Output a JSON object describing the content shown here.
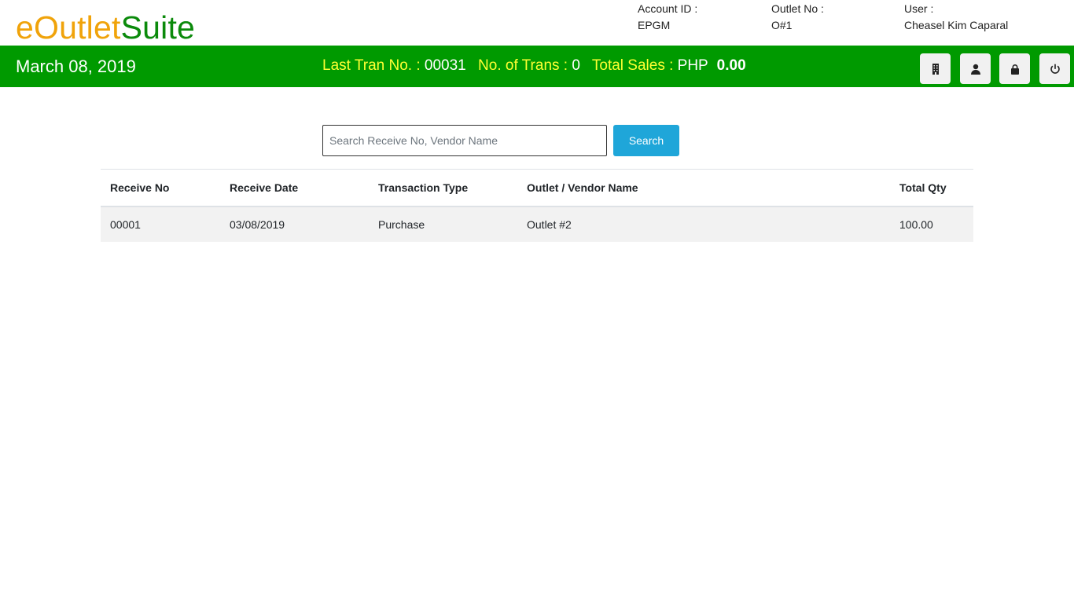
{
  "brand": {
    "part1": "eOutlet",
    "part2": "Suite"
  },
  "account": {
    "label": "Account ID :",
    "value": "EPGM"
  },
  "outlet": {
    "label": "Outlet No :",
    "value": "O#1"
  },
  "user": {
    "label": "User :",
    "value": "Cheasel Kim Caparal"
  },
  "bar": {
    "date": "March 08, 2019",
    "last_tran_label": "Last Tran No. :",
    "last_tran_value": "00031",
    "no_trans_label": "No. of Trans :",
    "no_trans_value": "0",
    "total_sales_label": "Total Sales :",
    "currency": "PHP",
    "total_sales_value": "0.00"
  },
  "icons": {
    "building": "building-icon",
    "user": "user-icon",
    "lock": "lock-icon",
    "power": "power-icon"
  },
  "search": {
    "placeholder": "Search Receive No, Vendor Name",
    "value": "",
    "button_label": "Search"
  },
  "table": {
    "headers": [
      "Receive No",
      "Receive Date",
      "Transaction Type",
      "Outlet / Vendor Name",
      "Total Qty"
    ],
    "rows": [
      [
        "00001",
        "03/08/2019",
        "Purchase",
        "Outlet #2",
        "100.00"
      ]
    ]
  },
  "colors": {
    "brand_orange": "#f0a30a",
    "brand_green": "#0b8a0b",
    "bar_green": "#009a00",
    "bar_label_yellow": "#ffff33",
    "search_button": "#1fa6d9"
  }
}
